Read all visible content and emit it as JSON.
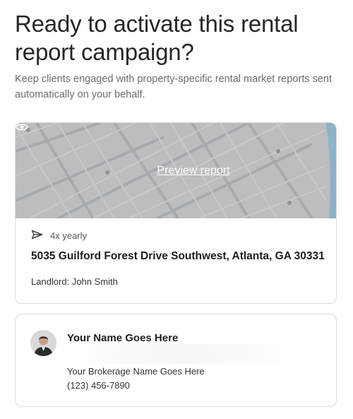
{
  "header": {
    "title": "Ready to activate this rental report campaign?",
    "subtitle": "Keep clients engaged with property-specific rental market reports sent automatically on your behalf."
  },
  "report_card": {
    "preview_label": "Preview report",
    "frequency": "4x yearly",
    "address": "5035 Guilford Forest Drive Southwest, Atlanta, GA 30331",
    "landlord": "Landlord: John Smith"
  },
  "agent_card": {
    "name": "Your Name Goes Here",
    "brokerage": "Your Brokerage Name Goes Here",
    "phone": "(123) 456-7890"
  },
  "colors": {
    "map_overlay": "#b9b9b9",
    "road": "#9aa0a6",
    "map_water": "#6fa7c6"
  },
  "icons": [
    "eye-icon",
    "send-icon"
  ]
}
